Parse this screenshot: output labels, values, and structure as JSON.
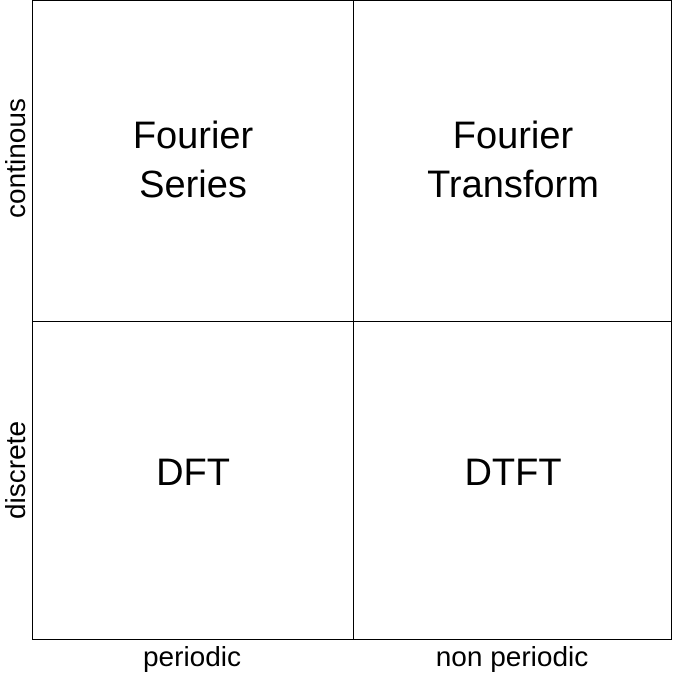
{
  "cells": {
    "continuous_periodic": "Fourier\nSeries",
    "continuous_nonperiodic": "Fourier\nTransform",
    "discrete_periodic": "DFT",
    "discrete_nonperiodic": "DTFT"
  },
  "axes": {
    "x": [
      "periodic",
      "non periodic"
    ],
    "y": [
      "continous",
      "discrete"
    ]
  }
}
